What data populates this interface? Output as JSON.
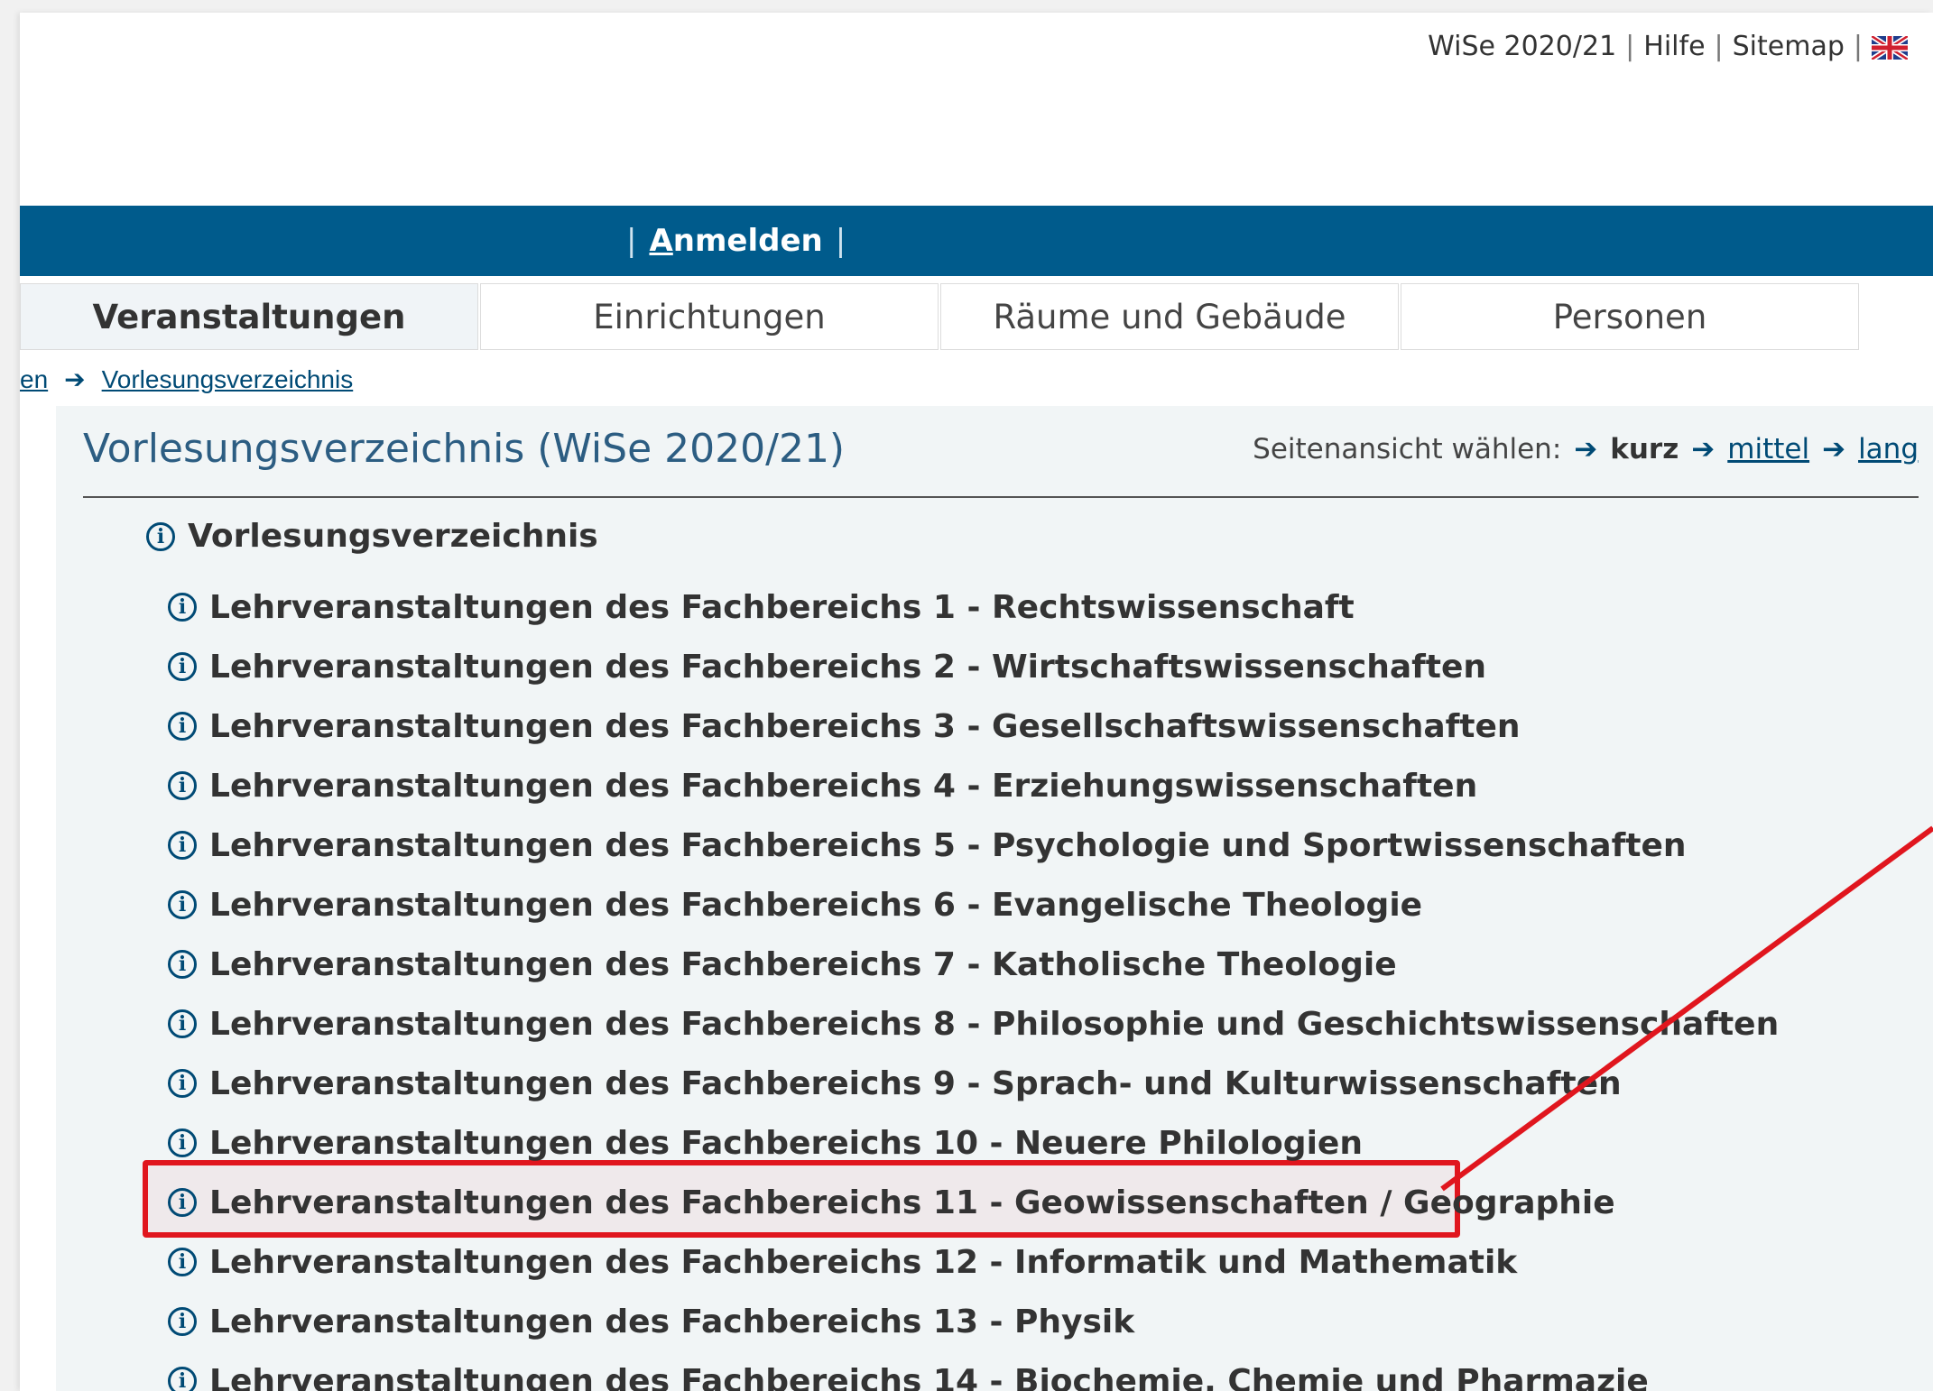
{
  "header": {
    "semester": "WiSe 2020/21",
    "help": "Hilfe",
    "sitemap": "Sitemap",
    "separator": "|",
    "language_icon": "uk-flag-icon"
  },
  "navbar": {
    "login": "Anmelden",
    "separator": "|",
    "color": "#005b8c"
  },
  "tabs": [
    {
      "label": "Veranstaltungen",
      "active": true
    },
    {
      "label": "Einrichtungen",
      "active": false
    },
    {
      "label": "Räume und Gebäude",
      "active": false
    },
    {
      "label": "Personen",
      "active": false
    }
  ],
  "breadcrumb": {
    "prev": "en",
    "current": "Vorlesungsverzeichnis",
    "arrow": "➔"
  },
  "main": {
    "title": "Vorlesungsverzeichnis (WiSe 2020/21)",
    "view_select": {
      "label": "Seitenansicht wählen:",
      "arrow": "➔",
      "options": [
        "kurz",
        "mittel",
        "lang"
      ],
      "selected": "kurz"
    },
    "tree": {
      "root": "Vorlesungsverzeichnis",
      "items": [
        "Lehrveranstaltungen des Fachbereichs 1 - Rechtswissenschaft",
        "Lehrveranstaltungen des Fachbereichs 2 - Wirtschaftswissenschaften",
        "Lehrveranstaltungen des Fachbereichs 3 - Gesellschaftswissenschaften",
        "Lehrveranstaltungen des Fachbereichs 4 - Erziehungswissenschaften",
        "Lehrveranstaltungen des Fachbereichs 5 - Psychologie und Sportwissenschaften",
        "Lehrveranstaltungen des Fachbereichs 6 - Evangelische Theologie",
        "Lehrveranstaltungen des Fachbereichs 7 - Katholische Theologie",
        "Lehrveranstaltungen des Fachbereichs 8 - Philosophie und Geschichtswissenschaften",
        "Lehrveranstaltungen des Fachbereichs 9 - Sprach- und Kulturwissenschaften",
        "Lehrveranstaltungen des Fachbereichs 10 - Neuere Philologien",
        "Lehrveranstaltungen des Fachbereichs 11 - Geowissenschaften / Geographie",
        "Lehrveranstaltungen des Fachbereichs 12 - Informatik und Mathematik",
        "Lehrveranstaltungen des Fachbereichs 13 - Physik",
        "Lehrveranstaltungen des Fachbereichs 14 - Biochemie, Chemie und Pharmazie"
      ],
      "highlighted_index": 10,
      "highlight_color": "#e0161e"
    }
  }
}
